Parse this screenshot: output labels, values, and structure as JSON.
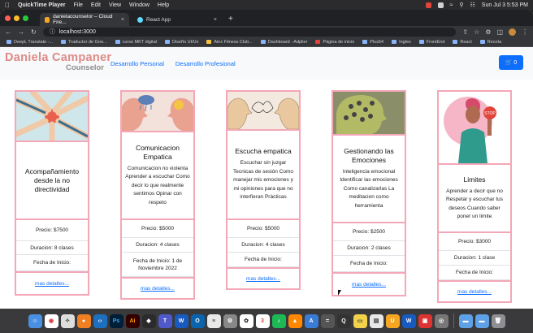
{
  "menubar": {
    "app": "QuickTime Player",
    "items": [
      "File",
      "Edit",
      "View",
      "Window",
      "Help"
    ],
    "clock": "Sun Jul 3  5:53 PM"
  },
  "browser": {
    "tabs": [
      {
        "title": "danielacounselor – Cloud Fire...",
        "active": true
      },
      {
        "title": "React App",
        "active": false
      }
    ],
    "new_tab": "+",
    "url": "localhost:3000",
    "bookmarks": [
      "DeepL Translate -...",
      "Traductor de Goo...",
      "curso MKT digital",
      "Diseño UI/Ux",
      "Alex Fitness Club...",
      "Dashboard - Adplier",
      "Página de inicio",
      "Plus54",
      "Ingles",
      "FrontEnd",
      "React",
      "Receta"
    ]
  },
  "site": {
    "brand_name": "Daniela Campaner",
    "brand_tag": "Counselor",
    "nav": [
      "Desarrollo Personal",
      "Desarrollo Profesional"
    ],
    "cart_count": "0"
  },
  "cards": [
    {
      "title": "Acompañamiento desde la no directividad",
      "desc": "",
      "price": "Precio: $7500",
      "duration": "Duracion: 8 clases",
      "start": "Fecha de Inicio:",
      "link": "mas detalles..."
    },
    {
      "title": "Comunicacion Empatica",
      "desc": "Comunicacion no violenta Aprender a escuchar Como decir lo que realmente sentimos Opinar con respeto",
      "price": "Precio: $5000",
      "duration": "Duracion: 4 clases",
      "start": "Fecha de Inicio: 1 de Noviembre 2022",
      "link": "mas detalles..."
    },
    {
      "title": "Escucha empatica",
      "desc": "Escuchar sin juzgar Tecnicas de sesión Como manejar mis emociones y mi opiniones para que no interfieran Prácticas",
      "price": "Precio: $5000",
      "duration": "Duracion: 4 clases",
      "start": "Fecha de Inicio:",
      "link": "mas detalles..."
    },
    {
      "title": "Gestionando las Emociones",
      "desc": "Inteligencia emocional Identificar las emociones Como canalizarlas La meditacion como herramienta",
      "price": "Precio: $2500",
      "duration": "Duracion: 2 clases",
      "start": "Fecha de Inicio:",
      "link": "mas detalles..."
    },
    {
      "title": "Limites",
      "desc": "Aprender a decir que no Respetar y escuchar tus deseos Cuando saber poner un limite",
      "price": "Precio: $3000",
      "duration": "Duracion: 1 clase",
      "start": "Fecha de Inicio:",
      "link": "mas detalles..."
    }
  ],
  "dock": {
    "calendar_day": "3"
  },
  "colors": {
    "card_border": "#f4a7b7",
    "link": "#0d6efd",
    "brand": "#dd8a86"
  }
}
